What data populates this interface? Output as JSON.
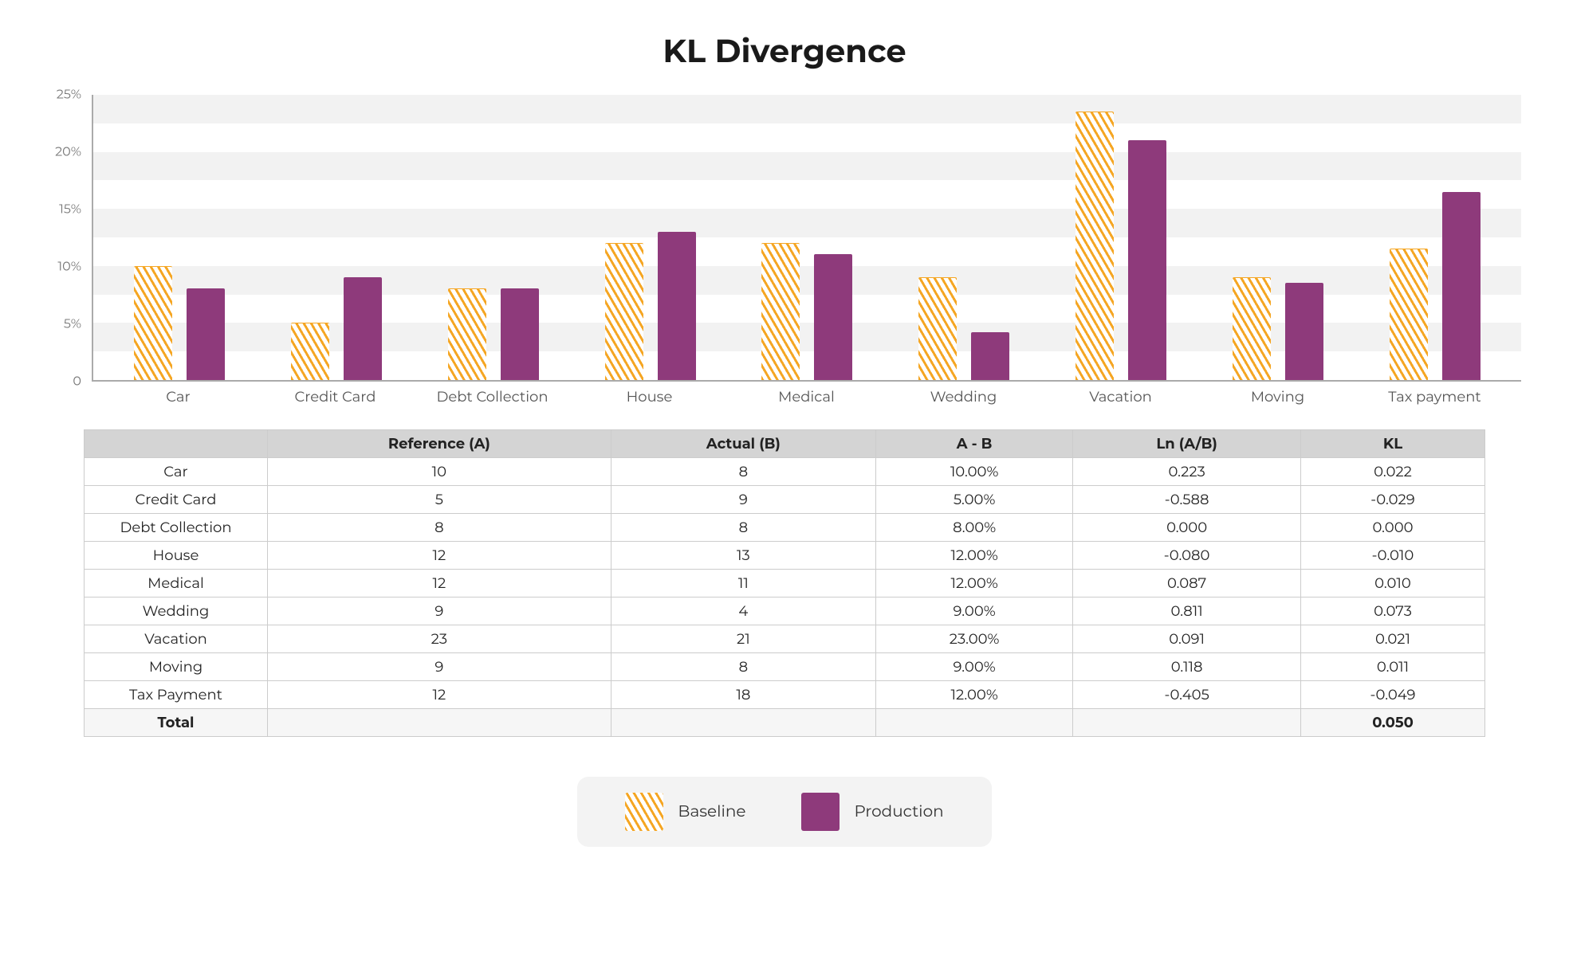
{
  "title": "KL Divergence",
  "legend": {
    "baseline": "Baseline",
    "production": "Production"
  },
  "chart_data": {
    "type": "bar",
    "title": "KL Divergence",
    "xlabel": "",
    "ylabel": "",
    "ylim": [
      0,
      25
    ],
    "y_ticks": [
      0,
      5,
      10,
      15,
      20,
      25
    ],
    "y_tick_labels": [
      "0",
      "5%",
      "10%",
      "15%",
      "20%",
      "25%"
    ],
    "categories": [
      "Car",
      "Credit Card",
      "Debt Collection",
      "House",
      "Medical",
      "Wedding",
      "Vacation",
      "Moving",
      "Tax payment"
    ],
    "series": [
      {
        "name": "Baseline",
        "values": [
          10.0,
          5.0,
          8.0,
          12.0,
          12.0,
          9.0,
          23.5,
          9.0,
          11.5
        ]
      },
      {
        "name": "Production",
        "values": [
          8.0,
          9.0,
          8.0,
          13.0,
          11.0,
          4.2,
          21.0,
          8.5,
          16.5
        ]
      }
    ]
  },
  "table": {
    "headers": [
      "",
      "Reference (A)",
      "Actual (B)",
      "A - B",
      "Ln (A/B)",
      "KL"
    ],
    "rows": [
      {
        "label": "Car",
        "ref": "10",
        "act": "8",
        "amb": "10.00%",
        "ln": "0.223",
        "kl": "0.022"
      },
      {
        "label": "Credit Card",
        "ref": "5",
        "act": "9",
        "amb": "5.00%",
        "ln": "-0.588",
        "kl": "-0.029"
      },
      {
        "label": "Debt Collection",
        "ref": "8",
        "act": "8",
        "amb": "8.00%",
        "ln": "0.000",
        "kl": "0.000"
      },
      {
        "label": "House",
        "ref": "12",
        "act": "13",
        "amb": "12.00%",
        "ln": "-0.080",
        "kl": "-0.010"
      },
      {
        "label": "Medical",
        "ref": "12",
        "act": "11",
        "amb": "12.00%",
        "ln": "0.087",
        "kl": "0.010"
      },
      {
        "label": "Wedding",
        "ref": "9",
        "act": "4",
        "amb": "9.00%",
        "ln": "0.811",
        "kl": "0.073"
      },
      {
        "label": "Vacation",
        "ref": "23",
        "act": "21",
        "amb": "23.00%",
        "ln": "0.091",
        "kl": "0.021"
      },
      {
        "label": "Moving",
        "ref": "9",
        "act": "8",
        "amb": "9.00%",
        "ln": "0.118",
        "kl": "0.011"
      },
      {
        "label": "Tax Payment",
        "ref": "12",
        "act": "18",
        "amb": "12.00%",
        "ln": "-0.405",
        "kl": "-0.049"
      }
    ],
    "total": {
      "label": "Total",
      "kl": "0.050"
    }
  }
}
